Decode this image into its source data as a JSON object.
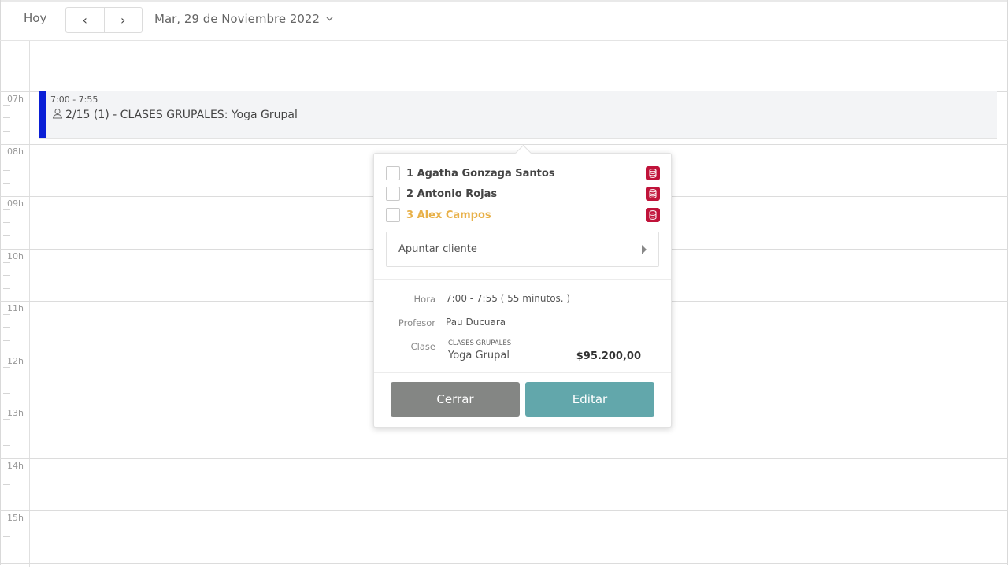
{
  "toolbar": {
    "today_label": "Hoy",
    "prev_label": "‹",
    "next_label": "›",
    "date_label": "Mar, 29 de Noviembre 2022"
  },
  "hours": [
    "07h",
    "08h",
    "09h",
    "10h",
    "11h",
    "12h",
    "13h",
    "14h",
    "15h"
  ],
  "event": {
    "time": "7:00 - 7:55",
    "title": "2/15 (1) - CLASES GRUPALES: Yoga Grupal",
    "color": "#0a1fd6"
  },
  "popover": {
    "attendees": [
      {
        "label": "1 Agatha Gonzaga Santos",
        "status": "normal"
      },
      {
        "label": "2 Antonio Rojas",
        "status": "normal"
      },
      {
        "label": "3 Alex Campos",
        "status": "warning"
      }
    ],
    "add_client_label": "Apuntar cliente",
    "details": {
      "hora_label": "Hora",
      "hora_value": "7:00 - 7:55 ( 55 minutos. )",
      "profesor_label": "Profesor",
      "profesor_value": "Pau Ducuara",
      "clase_label": "Clase",
      "clase_category": "CLASES GRUPALES",
      "clase_name": "Yoga Grupal",
      "price": "$95.200,00"
    },
    "close_label": "Cerrar",
    "edit_label": "Editar"
  },
  "colors": {
    "event_bar": "#0a1fd6",
    "db_icon": "#c0133a",
    "warning_name": "#e8b14a",
    "close_button": "#848684",
    "edit_button": "#62a7ab"
  }
}
